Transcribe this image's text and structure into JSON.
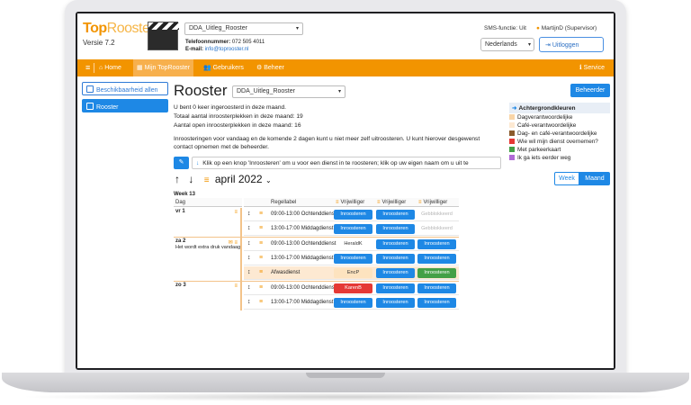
{
  "header": {
    "logo_top": "Top",
    "logo_rest": "Rooster",
    "version": "Versie 7.2",
    "company_select": "DDA_Uitleg_Rooster",
    "phone_label": "Telefoonnummer:",
    "phone": "072 505 4011",
    "mail_label": "E-mail:",
    "mail": "info@toprooster.nl",
    "sms": "SMS-functie: Uit",
    "user": "MartijnD (Supervisor)",
    "language": "Nederlands",
    "logout": "Uitloggen"
  },
  "nav": {
    "home": "Home",
    "mijn": "Mijn TopRooster",
    "gebruikers": "Gebruikers",
    "beheer": "Beheer",
    "service": "Service"
  },
  "sidebar": {
    "items": [
      {
        "label": "Beschikbaarheid allen"
      },
      {
        "label": "Rooster"
      }
    ]
  },
  "main": {
    "title": "Rooster",
    "schedule_select": "DDA_Uitleg_Rooster",
    "beheerder_button": "Beheerder",
    "info_lines": [
      "U bent 0 keer ingeroosterd in deze maand.",
      "Totaal aantal inroosterplekken in deze maand: 19",
      "Aantal open inroosterplekken in deze maand: 16"
    ],
    "notice": "Inroosteringen voor vandaag en de komende 2 dagen kunt u niet meer zelf uitroosteren. U kunt hierover desgewenst contact opnemen met de beheerder.",
    "hint": "Klik op een knop 'Inroosteren' om u voor een dienst in te roosteren; klik op uw eigen naam om u uit te",
    "month": "april 2022",
    "week_button": "Week",
    "month_button": "Maand"
  },
  "legend": {
    "title": "Achtergrondkleuren",
    "items": [
      {
        "label": "Dagverantwoordelijke",
        "color": "#f9d5a7"
      },
      {
        "label": "Café-verantwoordelijke",
        "color": "#fde9d2"
      },
      {
        "label": "Dag- en café-verantwoordelijke",
        "color": "#8a5a2b"
      },
      {
        "label": "Wie wil mijn dienst overnemen?",
        "color": "#e53935"
      },
      {
        "label": "Met parkeerkaart",
        "color": "#43a047"
      },
      {
        "label": "Ik ga iets eerder weg",
        "color": "#b06ad6"
      }
    ]
  },
  "table": {
    "week_label": "Week 13",
    "col_day": "Dag",
    "col_rule": "Regellabel",
    "col_volunteer": "Vrijwilliger",
    "days": [
      {
        "label": "vr 1",
        "note": ""
      },
      {
        "label": "za 2",
        "note": "Het wordt extra druk vandaag!"
      },
      {
        "label": "zo 3",
        "note": ""
      }
    ],
    "rows": [
      {
        "shift": "09:00-13:00 Ochtenddienst",
        "slots": [
          "Inroosteren",
          "Inroosteren",
          "Gebblokkeerd"
        ]
      },
      {
        "shift": "13:00-17:00 Middagdienst",
        "slots": [
          "Inroosteren",
          "Inroosteren",
          "Gebblokkeerd"
        ]
      },
      {
        "shift": "09:00-13:00 Ochtenddienst",
        "slots": [
          "HeraldK",
          "Inroosteren",
          "Inroosteren"
        ]
      },
      {
        "shift": "13:00-17:00 Middagdienst",
        "slots": [
          "Inroosteren",
          "Inroosteren",
          "Inroosteren"
        ]
      },
      {
        "shift": "Afwasdienst",
        "slots": [
          "EncP",
          "Inroosteren",
          "Inroosteren"
        ]
      },
      {
        "shift": "09:00-13:00 Ochtenddienst",
        "slots": [
          "KarenB",
          "Inroosteren",
          "Inroosteren"
        ]
      },
      {
        "shift": "13:00-17:00 Middagdienst",
        "slots": [
          "Inroosteren",
          "Inroosteren",
          "Inroosteren"
        ]
      }
    ]
  }
}
